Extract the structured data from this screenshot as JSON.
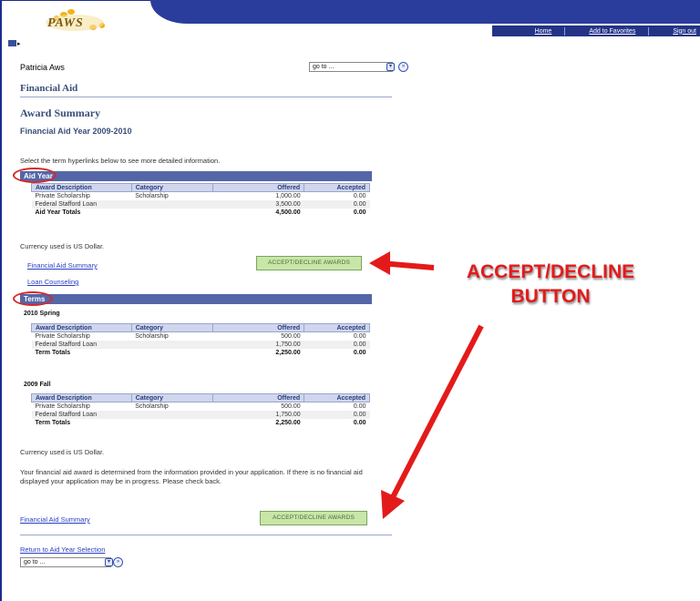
{
  "header": {
    "logo_text": "PAWS",
    "nav": [
      "Home",
      "Add to Favorites",
      "Sign out"
    ]
  },
  "user_name": "Patricia Aws",
  "goto_top": "go to ...",
  "goto_bottom": "go to ...",
  "headings": {
    "financial_aid": "Financial Aid",
    "award_summary": "Award Summary",
    "aid_year": "Financial Aid Year 2009-2010"
  },
  "instruction": "Select the term hyperlinks below to see more detailed information.",
  "aid_year_section": {
    "title": "Aid Year",
    "columns": [
      "Award Description",
      "Category",
      "Offered",
      "Accepted"
    ],
    "rows": [
      [
        "Private Scholarship",
        "Scholarship",
        "1,000.00",
        "0.00"
      ],
      [
        "Federal Stafford Loan",
        "",
        "3,500.00",
        "0.00"
      ]
    ],
    "totals": [
      "Aid Year Totals",
      "",
      "4,500.00",
      "0.00"
    ]
  },
  "currency_note_1": "Currency used is US Dollar.",
  "link_fa_summary_1": "Financial Aid Summary",
  "link_loan_counseling": "Loan Counseling",
  "accept_button_1": "ACCEPT/DECLINE AWARDS",
  "terms_section": {
    "title": "Terms",
    "terms": [
      {
        "name": "2010 Spring",
        "columns": [
          "Award Description",
          "Category",
          "Offered",
          "Accepted"
        ],
        "rows": [
          [
            "Private Scholarship",
            "Scholarship",
            "500.00",
            "0.00"
          ],
          [
            "Federal Stafford Loan",
            "",
            "1,750.00",
            "0.00"
          ]
        ],
        "totals": [
          "Term Totals",
          "",
          "2,250.00",
          "0.00"
        ]
      },
      {
        "name": "2009 Fall",
        "columns": [
          "Award Description",
          "Category",
          "Offered",
          "Accepted"
        ],
        "rows": [
          [
            "Private Scholarship",
            "Scholarship",
            "500.00",
            "0.00"
          ],
          [
            "Federal Stafford Loan",
            "",
            "1,750.00",
            "0.00"
          ]
        ],
        "totals": [
          "Term Totals",
          "",
          "2,250.00",
          "0.00"
        ]
      }
    ]
  },
  "currency_note_2": "Currency used is US Dollar.",
  "award_note": "Your financial aid award is determined from the information provided in your application. If there is no financial aid displayed your application may be in progress. Please check back.",
  "link_fa_summary_2": "Financial Aid Summary",
  "accept_button_2": "ACCEPT/DECLINE AWARDS",
  "link_return": "Return to Aid Year Selection",
  "callout": {
    "line1": "ACCEPT/DECLINE",
    "line2": "BUTTON",
    "color": "#e41a1a"
  },
  "colors": {
    "nav_band": "#2a3d9c",
    "section_bar": "#5466a8",
    "accept_button": "#c8e6a8",
    "annotation_red": "#d42a2a"
  }
}
